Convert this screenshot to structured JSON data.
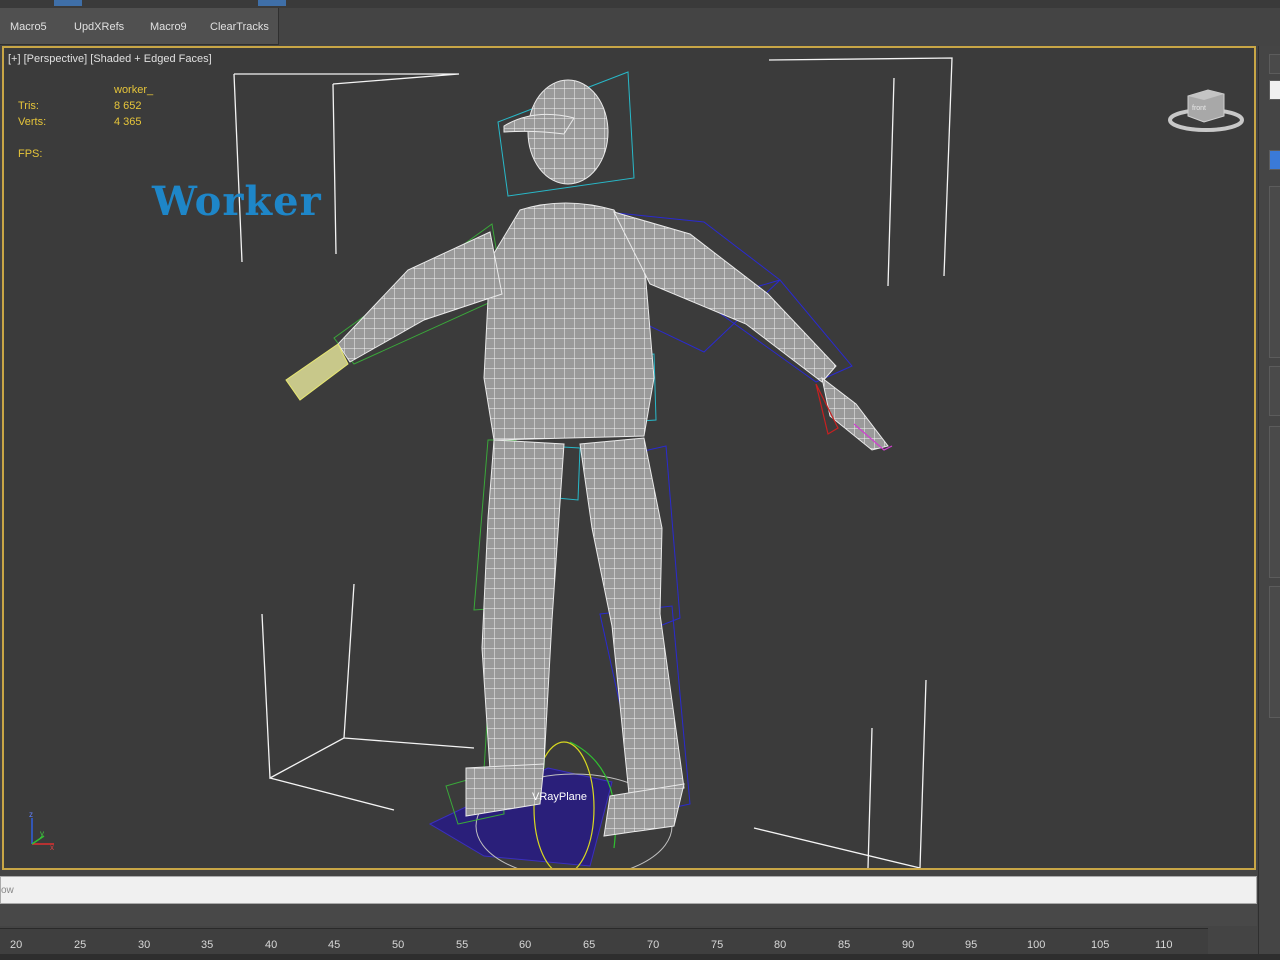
{
  "toolbar": {
    "buttons": [
      "Macro5",
      "UpdXRefs",
      "Macro9",
      "ClearTracks"
    ]
  },
  "viewport": {
    "label_plus": "[+]",
    "label_view": "[Perspective]",
    "label_shading": "[Shaded + Edged Faces]",
    "stats": {
      "object_name": "worker_",
      "tris_label": "Tris:",
      "tris_value": "8 652",
      "verts_label": "Verts:",
      "verts_value": "4 365",
      "fps_label": "FPS:"
    },
    "overlay_title": "Worker",
    "vray_plane_label": "VRayPlane",
    "viewcube_label": "front"
  },
  "command_line": {
    "value": "ow"
  },
  "timeline": {
    "ticks": [
      "20",
      "25",
      "30",
      "35",
      "40",
      "45",
      "50",
      "55",
      "60",
      "65",
      "70",
      "75",
      "80",
      "85",
      "90",
      "95",
      "100",
      "105",
      "110"
    ]
  },
  "colors": {
    "viewport_border": "#c8a646",
    "stats_text": "#e6c53a",
    "title_blue": "#1e86c8",
    "viewport_bg": "#3b3b3b"
  }
}
